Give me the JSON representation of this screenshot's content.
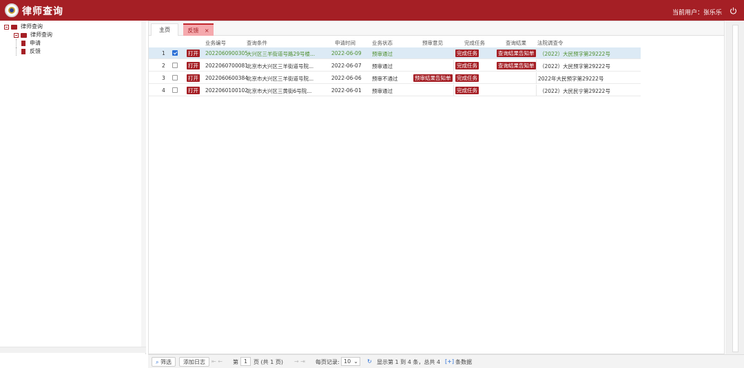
{
  "header": {
    "title": "律师查询",
    "user_label": "当前用户：张乐乐"
  },
  "tree": {
    "root": "律师查询",
    "child": "律师查询",
    "leaves": [
      "申请",
      "反馈"
    ]
  },
  "tabs": [
    {
      "label": "主页"
    },
    {
      "label": "反馈",
      "close": "×"
    }
  ],
  "grid": {
    "columns": [
      "业务编号",
      "查询条件",
      "申请时间",
      "业务状态",
      "预审意见",
      "完成任务",
      "查询结果",
      "法院调查令"
    ],
    "open_label": "打开",
    "rows": [
      {
        "index": "1",
        "checked": true,
        "id": "2022060900305",
        "condition": "大兴区三羊街道号路29号楼...",
        "date": "2022-06-09",
        "status": "预审通过",
        "opinion": "",
        "task": "完成任务",
        "result": "查询结果告知单",
        "order": "（2022）大民预字第29222号"
      },
      {
        "index": "2",
        "checked": false,
        "id": "2022060700081",
        "condition": "北京市大兴区三羊街道号院...",
        "date": "2022-06-07",
        "status": "预审通过",
        "opinion": "",
        "task": "完成任务",
        "result": "查询结果告知单",
        "order": "（2022）大民预字第29222号"
      },
      {
        "index": "3",
        "checked": false,
        "id": "2022060600384",
        "condition": "北京市大兴区三羊街道号院...",
        "date": "2022-06-06",
        "status": "预审不通过",
        "opinion": "预审结果告知单",
        "task": "完成任务",
        "result": "",
        "order": "2022年大民预字第29222号"
      },
      {
        "index": "4",
        "checked": false,
        "id": "2022060100102",
        "condition": "北京市大兴区三黄街6号院...",
        "date": "2022-06-01",
        "status": "预审通过",
        "opinion": "",
        "task": "完成任务",
        "result": "",
        "order": "（2022）大民民宁第29222号"
      }
    ]
  },
  "pager": {
    "filter_label": "筛选",
    "log_label": "添加日志",
    "page_prefix": "第",
    "page_value": "1",
    "page_suffix": "页 (共 1 页)",
    "page_size_label": "每页记录:",
    "page_size": "10",
    "summary": "显示第 1 到 4 条，总共 4",
    "summary_plus": "[+]",
    "summary_tail": "条数据"
  },
  "colors": {
    "brand": "#a51f25",
    "selected_row": "#dceaf5",
    "tab_active": "#f5a9ad"
  }
}
